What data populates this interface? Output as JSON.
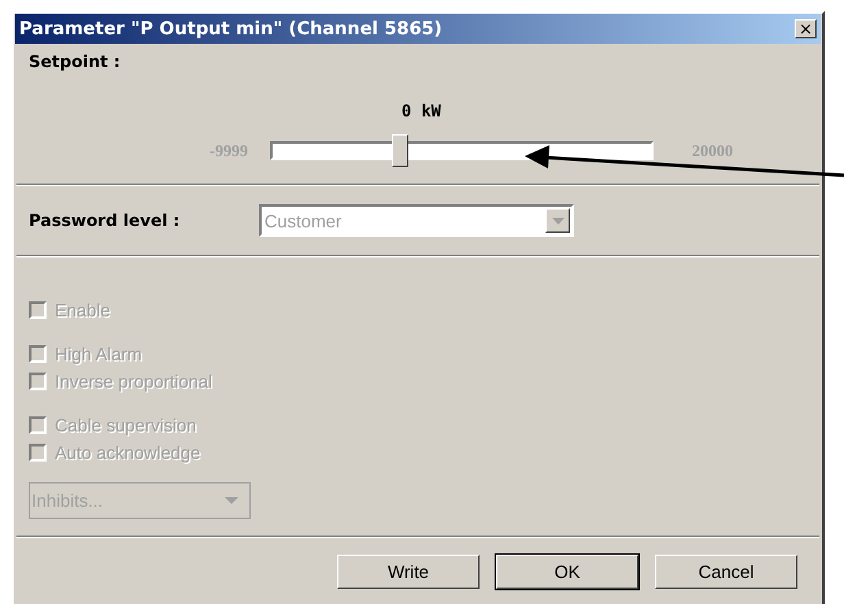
{
  "window": {
    "title": "Parameter \"P Output min\" (Channel 5865)",
    "close": "×"
  },
  "setpoint": {
    "label": "Setpoint :",
    "value": "0 kW",
    "min": "-9999",
    "max": "20000",
    "level": 0.34
  },
  "password": {
    "label": "Password level :",
    "value": "Customer",
    "disabled": true
  },
  "options": [
    {
      "label": "Enable",
      "checked": false,
      "disabled": true
    },
    {
      "label": "High Alarm",
      "checked": false,
      "disabled": true
    },
    {
      "label": "Inverse proportional",
      "checked": false,
      "disabled": true
    },
    {
      "label": "Cable supervision",
      "checked": false,
      "disabled": true
    },
    {
      "label": "Auto acknowledge",
      "checked": false,
      "disabled": true
    }
  ],
  "inhibits": {
    "value": "Inhibits...",
    "disabled": true
  },
  "buttons": [
    {
      "label": "Write",
      "default": false
    },
    {
      "label": "OK",
      "default": true
    },
    {
      "label": "Cancel",
      "default": false
    }
  ]
}
